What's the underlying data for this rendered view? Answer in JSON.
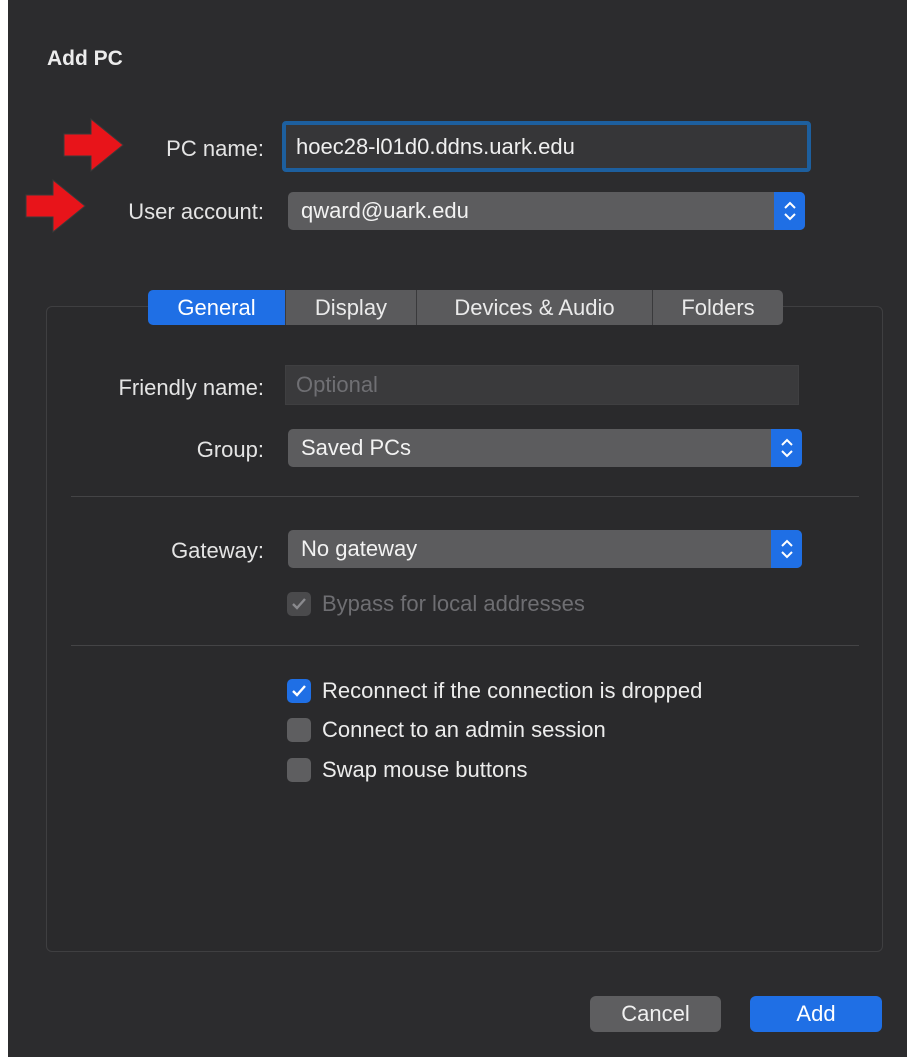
{
  "dialog": {
    "title": "Add PC"
  },
  "pc_name": {
    "label": "PC name:",
    "value": "hoec28-l01d0.ddns.uark.edu"
  },
  "user_account": {
    "label": "User account:",
    "value": "qward@uark.edu"
  },
  "tabs": [
    {
      "label": "General",
      "active": true
    },
    {
      "label": "Display",
      "active": false
    },
    {
      "label": "Devices & Audio",
      "active": false
    },
    {
      "label": "Folders",
      "active": false
    }
  ],
  "general": {
    "friendly_name": {
      "label": "Friendly name:",
      "placeholder": "Optional",
      "value": ""
    },
    "group": {
      "label": "Group:",
      "value": "Saved PCs"
    },
    "gateway": {
      "label": "Gateway:",
      "value": "No gateway"
    },
    "bypass": {
      "label": "Bypass for local addresses",
      "checked": true,
      "disabled": true
    },
    "options": [
      {
        "label": "Reconnect if the connection is dropped",
        "checked": true
      },
      {
        "label": "Connect to an admin session",
        "checked": false
      },
      {
        "label": "Swap mouse buttons",
        "checked": false
      }
    ]
  },
  "buttons": {
    "cancel": "Cancel",
    "add": "Add"
  },
  "annotations": {
    "arrow_color": "#e8141a"
  },
  "colors": {
    "accent": "#1f6fe5",
    "background": "#2c2c2e"
  },
  "icons": {
    "stepper": "chevron-up-down-icon",
    "check": "checkmark-icon",
    "annotation": "red-arrow-icon"
  }
}
